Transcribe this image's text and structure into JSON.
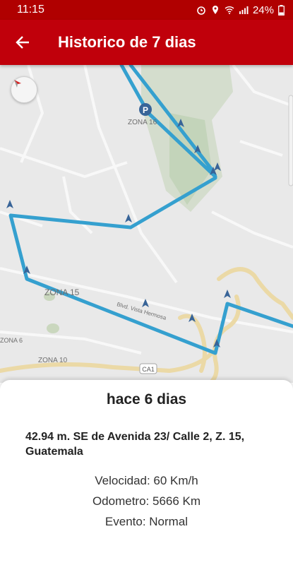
{
  "status": {
    "time": "11:15",
    "battery": "24%"
  },
  "header": {
    "title": "Historico de 7 dias"
  },
  "map": {
    "zone_labels": [
      "ZONA 16",
      "ZONA 15",
      "ZONA 10",
      "ZONA 6"
    ],
    "road_labels": [
      "Blvd. Vista Hermosa",
      "CA1"
    ],
    "parking_marker": "P",
    "route_color": "#1a93c9"
  },
  "details": {
    "time_ago": "hace 6 dias",
    "address": "42.94 m. SE de  Avenida 23/ Calle 2, Z. 15, Guatemala",
    "speed": "Velocidad: 60 Km/h",
    "odometer": "Odometro: 5666 Km",
    "event": "Evento: Normal"
  }
}
